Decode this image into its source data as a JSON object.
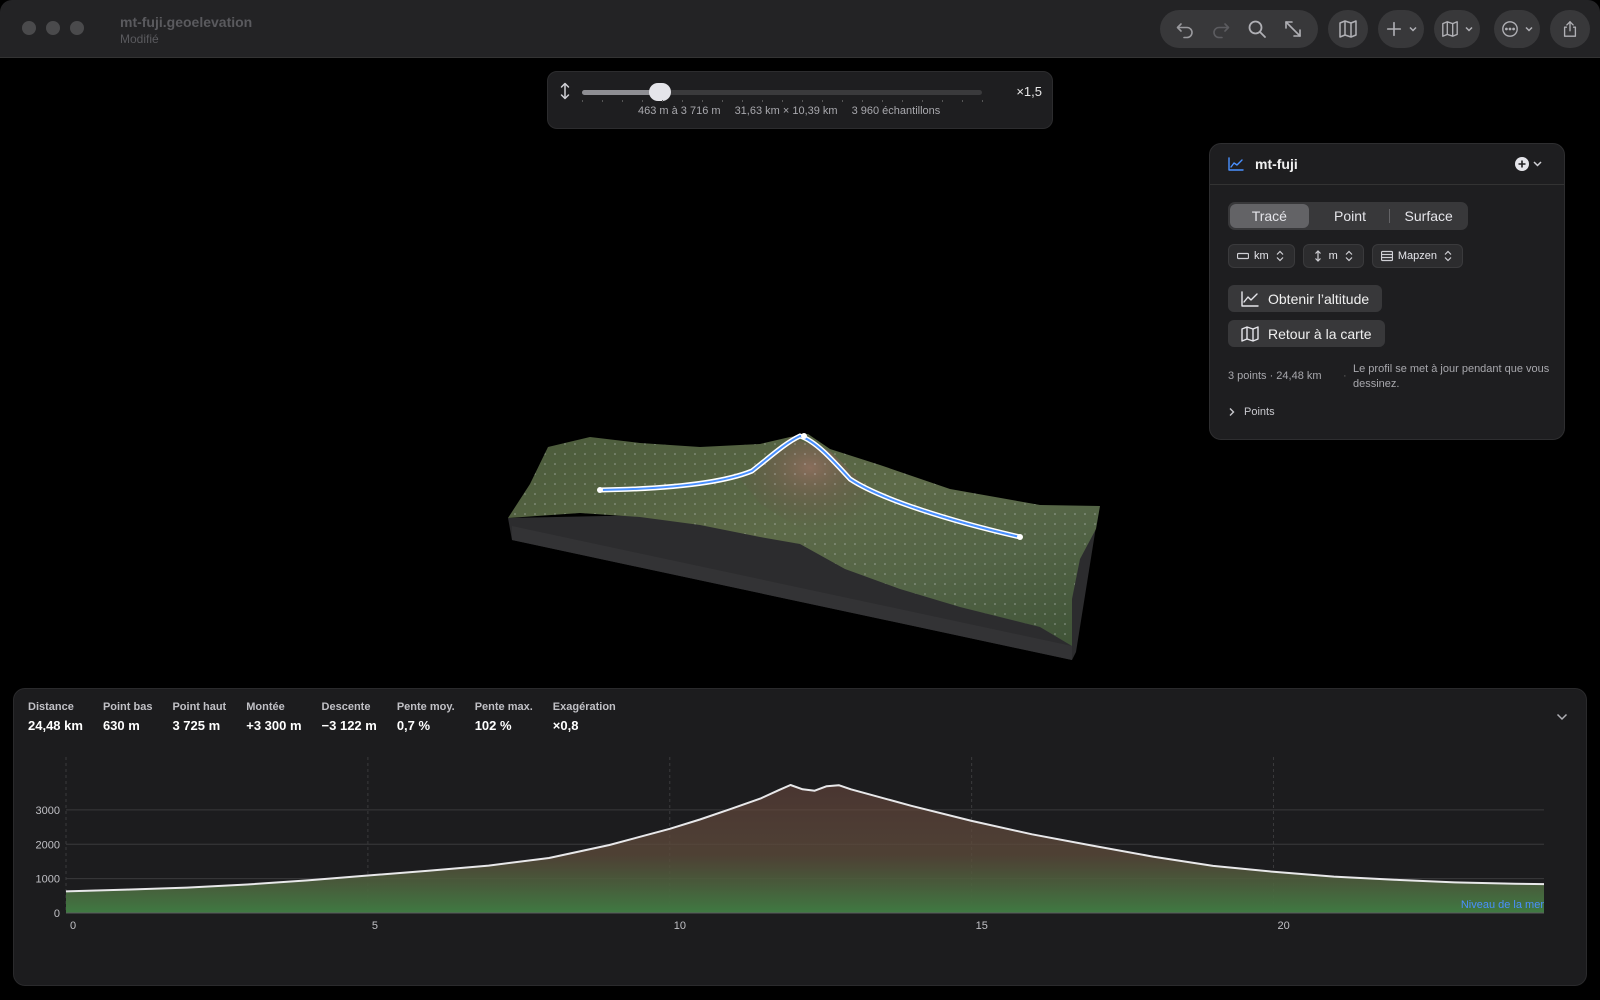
{
  "window": {
    "title": "mt-fuji.geoelevation",
    "subtitle": "Modifié"
  },
  "toolbar": {
    "icons": [
      "undo-icon",
      "redo-icon",
      "search-icon",
      "expand-icon",
      "map-icon",
      "plus-icon",
      "map-style-icon",
      "more-icon",
      "share-icon"
    ]
  },
  "exaggeration": {
    "value_label": "×1,5",
    "level": 0.195,
    "range": "463 m à 3 716 m",
    "extent": "31,63 km × 10,39 km",
    "samples": "3 960 échantillons"
  },
  "panel": {
    "name": "mt-fuji",
    "segments": [
      "Tracé",
      "Point",
      "Surface"
    ],
    "active_segment": 0,
    "distance_unit": "km",
    "elevation_unit": "m",
    "source": "Mapzen",
    "get_elevation_label": "Obtenir l’altitude",
    "back_to_map_label": "Retour à la carte",
    "summary": "3 points · 24,48 km",
    "hint": "Le profil se met à jour pendant que vous dessinez.",
    "points_label": "Points"
  },
  "stats": [
    {
      "label": "Distance",
      "value": "24,48 km"
    },
    {
      "label": "Point bas",
      "value": "630 m"
    },
    {
      "label": "Point haut",
      "value": "3 725 m"
    },
    {
      "label": "Montée",
      "value": "+3 300 m"
    },
    {
      "label": "Descente",
      "value": "−3 122 m"
    },
    {
      "label": "Pente moy.",
      "value": "0,7 %"
    },
    {
      "label": "Pente max.",
      "value": "102 %"
    },
    {
      "label": "Exagération",
      "value": "×0,8"
    }
  ],
  "chart_data": {
    "type": "area",
    "title": "",
    "xlabel": "",
    "ylabel": "",
    "xlim": [
      0,
      24.48
    ],
    "ylim": [
      0,
      3725
    ],
    "x_ticks": [
      0,
      5,
      10,
      15,
      20
    ],
    "y_ticks": [
      0,
      1000,
      2000,
      3000
    ],
    "y_tick_labels": [
      "0",
      "1000",
      "2000",
      "3000"
    ],
    "sea_level_label": "Niveau de la mer",
    "grid": true,
    "x": [
      0,
      1,
      2,
      3,
      4,
      5,
      6,
      7,
      8,
      9,
      10,
      10.5,
      11,
      11.5,
      11.8,
      12.0,
      12.2,
      12.4,
      12.6,
      12.8,
      13,
      14,
      15,
      16,
      17,
      18,
      19,
      20,
      21,
      22,
      23,
      24,
      24.48
    ],
    "y": [
      630,
      680,
      740,
      830,
      950,
      1090,
      1230,
      1380,
      1600,
      1980,
      2450,
      2720,
      3020,
      3330,
      3570,
      3725,
      3600,
      3560,
      3690,
      3720,
      3600,
      3120,
      2680,
      2290,
      1960,
      1640,
      1370,
      1200,
      1060,
      970,
      890,
      850,
      840
    ]
  }
}
